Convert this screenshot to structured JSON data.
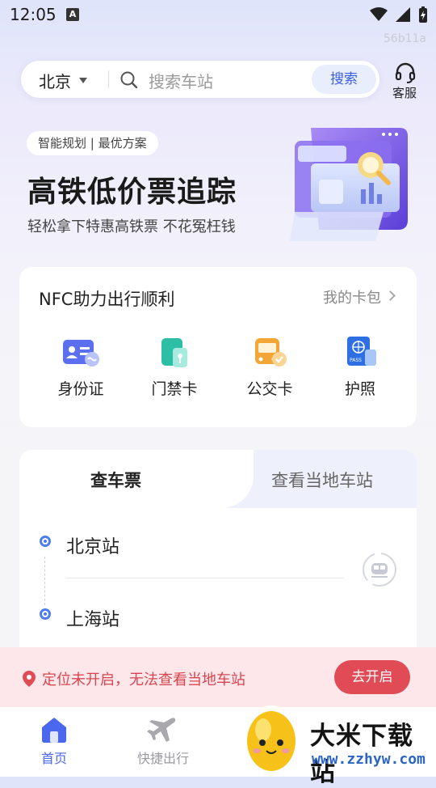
{
  "status_bar": {
    "time": "12:05",
    "notif_glyph": "A",
    "build_id": "56b11a"
  },
  "search": {
    "city": "北京",
    "placeholder": "搜索车站",
    "button": "搜索"
  },
  "customer_service": {
    "label": "客服"
  },
  "banner": {
    "tag": "智能规划 | 最优方案",
    "title": "高铁低价票追踪",
    "subtitle": "轻松拿下特惠高铁票 不花冤枉钱"
  },
  "nfc": {
    "title": "NFC助力出行顺利",
    "link": "我的卡包",
    "items": [
      {
        "label": "身份证",
        "icon": "id-card-icon"
      },
      {
        "label": "门禁卡",
        "icon": "access-card-icon"
      },
      {
        "label": "公交卡",
        "icon": "bus-card-icon"
      },
      {
        "label": "护照",
        "icon": "passport-icon"
      }
    ]
  },
  "ticket": {
    "tabs": [
      "查车票",
      "查看当地车站"
    ],
    "from": "北京站",
    "to": "上海站"
  },
  "location": {
    "message": "定位未开启，无法查看当地车站",
    "button": "去开启"
  },
  "bottom_nav": [
    {
      "label": "首页",
      "active": true
    },
    {
      "label": "快捷出行",
      "active": false
    }
  ],
  "watermark": {
    "title": "大米下载站",
    "url": "www.zzhyw.com"
  },
  "colors": {
    "accent": "#3c5ee0",
    "alert": "#e14b56",
    "bg": "#f5f5f8"
  }
}
